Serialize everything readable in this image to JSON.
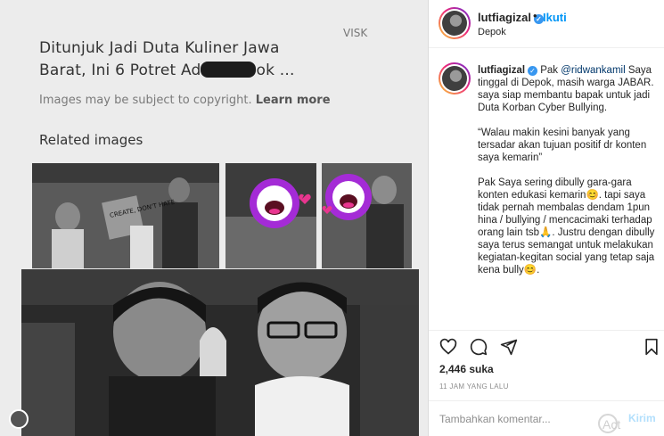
{
  "post_image": {
    "article_title_part1": "Ditunjuk Jadi Duta Kuliner Jawa",
    "article_title_part2a": "Barat, Ini 6 Potret Ad",
    "article_title_part2b": "ok ...",
    "corner_word": "VISK",
    "copyright_note": "Images may be subject to copyright.",
    "learn_more": "Learn more",
    "related_heading": "Related images",
    "sign_text": "CREATE, DON'T HATE"
  },
  "header": {
    "username": "lutfiagizal",
    "separator": "•",
    "follow_label": "Ikuti",
    "location": "Depok"
  },
  "caption": {
    "username": "lutfiagizal",
    "line1_a": "Pak ",
    "mention": "@ridwankamil",
    "line1_b": " Saya tinggal di Depok, masih warga JABAR. saya siap membantu bapak untuk jadi Duta Korban Cyber Bullying.",
    "para2": "“Walau makin kesini banyak yang tersadar akan tujuan positif dr konten saya kemarin”",
    "para3": "Pak Saya sering dibully gara-gara konten edukasi kemarin😊. tapi saya tidak pernah membalas dendam 1pun hina / bullying / mencacimaki terhadap orang lain tsb🙏. Justru dengan dibully saya terus semangat untuk melakukan kegiatan-kegitan social yang tetap saja kena bully😊."
  },
  "actions": {
    "icons": [
      "heart-icon",
      "comment-icon",
      "share-icon",
      "bookmark-icon"
    ]
  },
  "stats": {
    "likes": "2,446 suka",
    "time": "11 JAM YANG LALU"
  },
  "comment": {
    "placeholder": "Tambahkan komentar...",
    "post_label": "Kirim",
    "watermark": "Act"
  },
  "colors": {
    "accent": "#0095f6",
    "verified": "#3897f0",
    "sticker_purple": "#a42bd6",
    "sticker_pink": "#e8368f"
  }
}
